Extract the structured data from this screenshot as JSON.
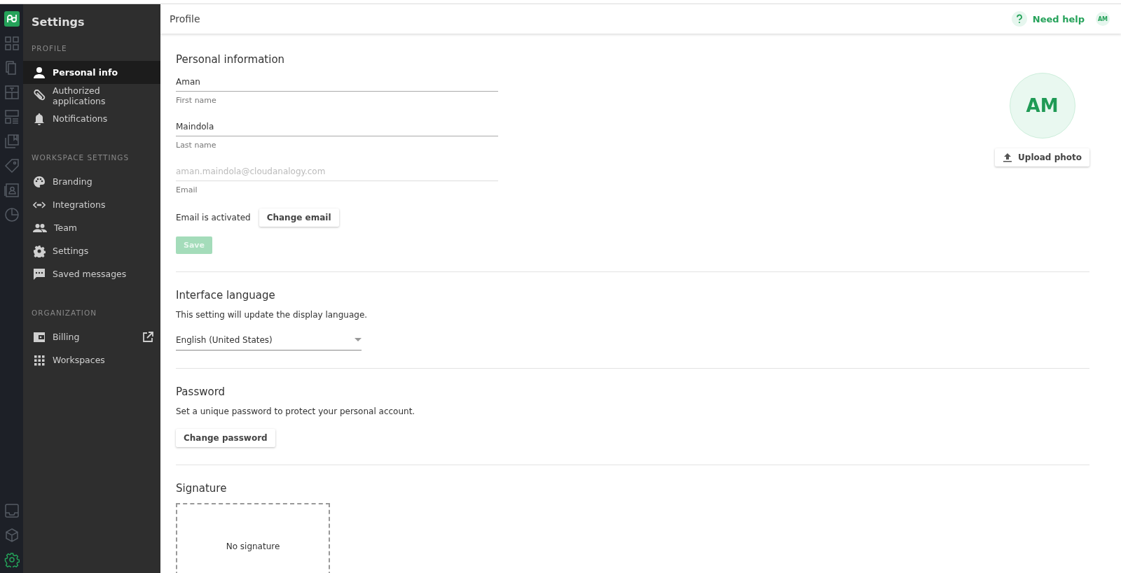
{
  "rail": {
    "items": [
      {
        "selected": false
      },
      {
        "selected": false
      },
      {
        "selected": false
      },
      {
        "selected": false
      },
      {
        "selected": false
      },
      {
        "selected": false
      },
      {
        "selected": false
      },
      {
        "selected": false
      }
    ],
    "bottom_items": [
      {
        "selected": false
      },
      {
        "selected": false
      },
      {
        "selected": true
      }
    ]
  },
  "sidebar": {
    "title": "Settings",
    "sections": [
      {
        "heading": "PROFILE",
        "items": [
          {
            "label": "Personal info",
            "selected": true,
            "external": false
          },
          {
            "label": "Authorized applications",
            "selected": false,
            "external": false
          },
          {
            "label": "Notifications",
            "selected": false,
            "external": false
          }
        ]
      },
      {
        "heading": "WORKSPACE SETTINGS",
        "items": [
          {
            "label": "Branding",
            "selected": false,
            "external": false
          },
          {
            "label": "Integrations",
            "selected": false,
            "external": false
          },
          {
            "label": "Team",
            "selected": false,
            "external": false
          },
          {
            "label": "Settings",
            "selected": false,
            "external": false
          },
          {
            "label": "Saved messages",
            "selected": false,
            "external": false
          }
        ]
      },
      {
        "heading": "ORGANIZATION",
        "items": [
          {
            "label": "Billing",
            "selected": false,
            "external": true
          },
          {
            "label": "Workspaces",
            "selected": false,
            "external": false
          }
        ]
      }
    ]
  },
  "header": {
    "title": "Profile",
    "help": "Need help",
    "avatar": "AM"
  },
  "personal": {
    "title": "Personal information",
    "fields": [
      {
        "value": "Aman",
        "label": "First name",
        "disabled": false
      },
      {
        "value": "Maindola",
        "label": "Last name",
        "disabled": false
      },
      {
        "value": "aman.maindola@cloudanalogy.com",
        "label": "Email",
        "disabled": true
      }
    ],
    "email_status": "Email is activated",
    "change_email": "Change email",
    "save": {
      "label": "Save",
      "disabled": true
    },
    "avatar": "AM",
    "upload": "Upload photo"
  },
  "language": {
    "title": "Interface language",
    "description": "This setting will update the display language.",
    "value": "English (United States)"
  },
  "password": {
    "title": "Password",
    "description": "Set a unique password to protect your personal account.",
    "button": "Change password"
  },
  "signature": {
    "title": "Signature",
    "empty": "No signature"
  }
}
